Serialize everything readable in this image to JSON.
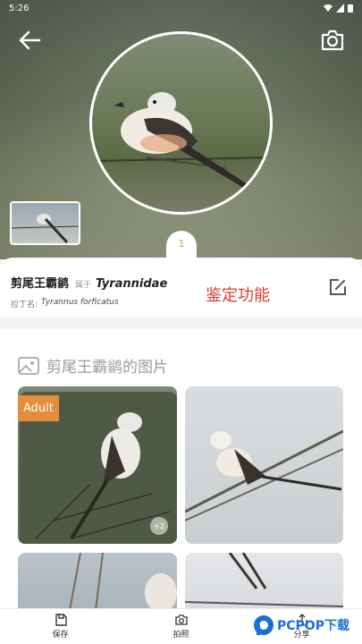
{
  "status_bar": {
    "time": "5:26"
  },
  "info": {
    "chinese_name": "剪尾王霸鹟",
    "belongs_label": "属于",
    "family": "Tyrannidae",
    "latin_label": "拉丁名:",
    "latin_name": "Tyrannus forficatus",
    "feature_label": "鉴定功能"
  },
  "photo_tab": {
    "index": "1"
  },
  "gallery": {
    "title": "剪尾王霸鹟的图片",
    "badge_adult": "Adult",
    "more_count": "+2"
  },
  "bottom_bar": {
    "items": [
      {
        "label": "保存",
        "icon": "save-icon"
      },
      {
        "label": "拍照",
        "icon": "camera-icon"
      },
      {
        "label": "分享",
        "icon": "share-icon"
      }
    ]
  },
  "watermark": {
    "text": "PCPOP下载"
  },
  "colors": {
    "accent": "#e03b2a",
    "badge": "#e58d3a",
    "watermark": "#1a6fd6"
  }
}
